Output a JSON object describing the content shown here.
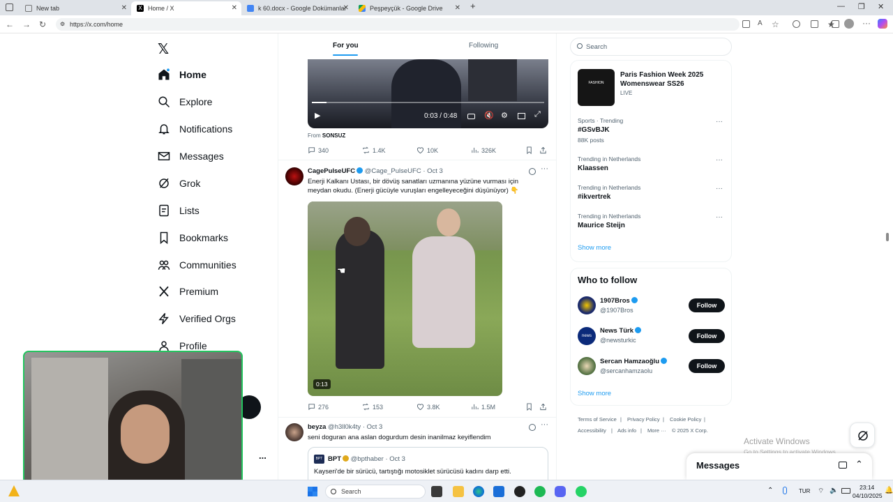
{
  "browser": {
    "tabs": [
      {
        "label": "New tab"
      },
      {
        "label": "Home / X"
      },
      {
        "label": "k 60.docx - Google Dokümanlar"
      },
      {
        "label": "Peşpeyçük - Google Drive"
      }
    ],
    "url": "https://x.com/home"
  },
  "nav": {
    "items": [
      {
        "label": "Home"
      },
      {
        "label": "Explore"
      },
      {
        "label": "Notifications"
      },
      {
        "label": "Messages"
      },
      {
        "label": "Grok"
      },
      {
        "label": "Lists"
      },
      {
        "label": "Bookmarks"
      },
      {
        "label": "Communities"
      },
      {
        "label": "Premium"
      },
      {
        "label": "Verified Orgs"
      },
      {
        "label": "Profile"
      }
    ],
    "more_dots": "..."
  },
  "feed": {
    "tabs": {
      "for_you": "For you",
      "following": "Following"
    },
    "video1": {
      "time": "0:03 / 0:48",
      "progress": 0.0625,
      "from_label": "From",
      "from_name": "SONSUZ",
      "stats": {
        "replies": "340",
        "reposts": "1.4K",
        "likes": "10K",
        "views": "326K"
      }
    },
    "tweet2": {
      "name": "CagePulseUFC",
      "handle": "@Cage_PulseUFC",
      "date": "· Oct 3",
      "text_line1": "Enerji Kalkanı Ustası, bir dövüş sanatları uzmanına yüzüne vurması için",
      "text_line2": "meydan okudu. (Enerji gücüyle vuruşları engelleyeceğini düşünüyor) 👇",
      "video_time": "0:13",
      "stats": {
        "replies": "276",
        "reposts": "153",
        "likes": "3.8K",
        "views": "1.5M"
      }
    },
    "tweet3": {
      "name": "beyza",
      "handle": "@h3ll0k4ty",
      "date": "· Oct 3",
      "text": "seni doguran ana aslan dogurdum desin inanilmaz keyiflendim",
      "quote_name": "BPT",
      "quote_avatar": "BPT",
      "quote_handle": "@bpthaber",
      "quote_date": "· Oct 3",
      "quote_text": "Kayseri'de bir sürücü, tartıştığı motosiklet sürücüsü kadını darp etti."
    }
  },
  "sidebar": {
    "search_placeholder": "Search",
    "fashion": {
      "title_line1": "Paris Fashion Week 2025",
      "title_line2": "Womenswear SS26",
      "status": "LIVE",
      "logo": "FASHION"
    },
    "trends": [
      {
        "meta": "Sports · Trending",
        "name": "#GSvBJK",
        "posts": "88K posts"
      },
      {
        "meta": "Trending in Netherlands",
        "name": "Klaassen"
      },
      {
        "meta": "Trending in Netherlands",
        "name": "#ikvertrek"
      },
      {
        "meta": "Trending in Netherlands",
        "name": "Maurice Steijn"
      }
    ],
    "show_more": "Show more",
    "who_to_follow": {
      "title": "Who to follow",
      "accounts": [
        {
          "name": "1907Bros",
          "handle": "@1907Bros"
        },
        {
          "name": "News Türk",
          "handle": "@newsturkic",
          "avatar_text": "news"
        },
        {
          "name": "Sercan Hamzaoğlu",
          "handle": "@sercanhamzaolu"
        }
      ],
      "follow_label": "Follow",
      "show_more": "Show more"
    },
    "footer": {
      "terms": "Terms of Service",
      "privacy": "Privacy Policy",
      "cookie": "Cookie Policy",
      "accessibility": "Accessibility",
      "ads": "Ads info",
      "more": "More ···",
      "copyright": "© 2025 X Corp."
    }
  },
  "messages_drawer": {
    "title": "Messages"
  },
  "watermark": {
    "line1": "Activate Windows",
    "line2": "Go to Settings to activate Windows."
  },
  "taskbar": {
    "search_placeholder": "Search",
    "lang": "TUR",
    "time": "23:14",
    "date": "04/10/2025"
  }
}
